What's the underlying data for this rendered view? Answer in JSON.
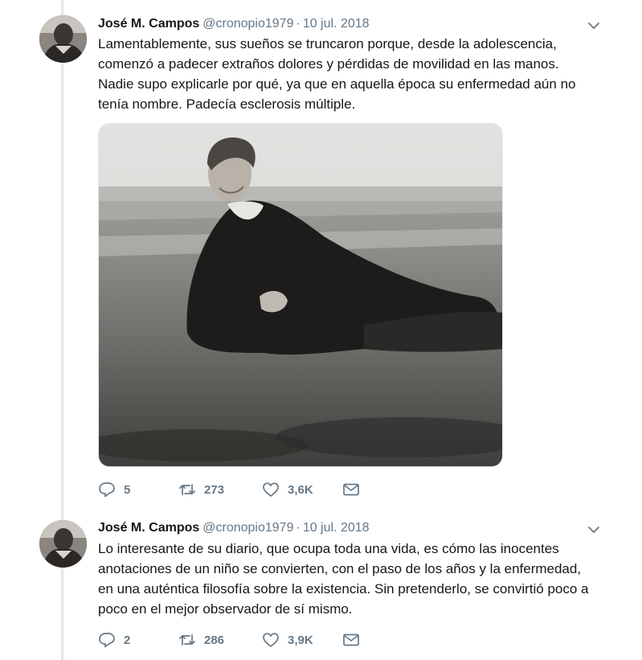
{
  "colors": {
    "text": "#14171a",
    "secondary": "#657786",
    "thread_line": "#e1e8ed"
  },
  "tweets": [
    {
      "author": "José M. Campos",
      "handle": "@cronopio1979",
      "separator": "·",
      "date": "10 jul. 2018",
      "text": "Lamentablemente, sus sueños se truncaron porque, desde la adolescencia,\ncomenzó a padecer extraños dolores y pérdidas de movilidad en las manos.\nNadie supo explicarle por qué, ya que en aquella época su enfermedad aún no\ntenía nombre. Padecía esclerosis múltiple.",
      "replies": "5",
      "retweets": "273",
      "likes": "3,6K",
      "icons": [
        "caret-down-icon",
        "reply-icon",
        "retweet-icon",
        "heart-icon",
        "mail-icon"
      ]
    },
    {
      "author": "José M. Campos",
      "handle": "@cronopio1979",
      "separator": "·",
      "date": "10 jul. 2018",
      "text": "Lo interesante de su diario, que ocupa toda una vida, es cómo las inocentes\nanotaciones de un niño se convierten, con el paso de los años y la enfermedad,\nen una auténtica filosofía sobre la existencia. Sin pretenderlo, se convirtió poco a\npoco en el mejor observador de sí mismo.",
      "replies": "2",
      "retweets": "286",
      "likes": "3,9K",
      "icons": [
        "caret-down-icon",
        "reply-icon",
        "retweet-icon",
        "heart-icon",
        "mail-icon"
      ]
    }
  ]
}
